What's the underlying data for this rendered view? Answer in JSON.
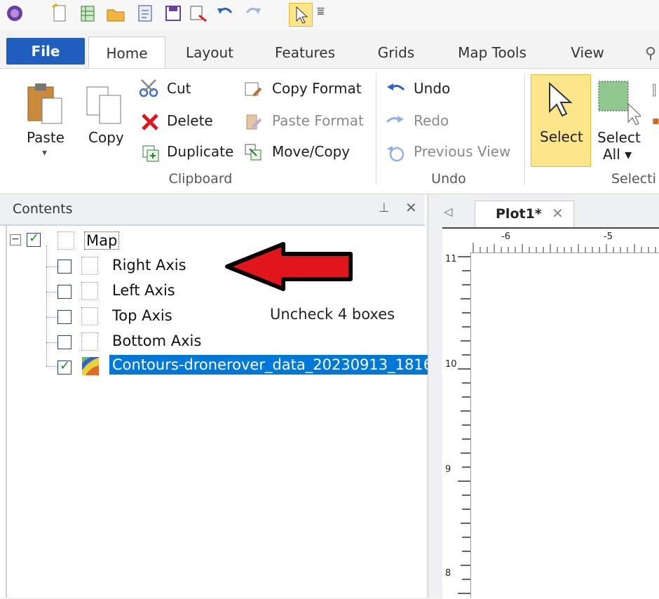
{
  "tabs": [
    "File",
    "Home",
    "Layout",
    "Features",
    "Grids",
    "Map Tools",
    "View"
  ],
  "ribbon": {
    "clipboard": {
      "paste": "Paste",
      "copy": "Copy",
      "cut": "Cut",
      "delete": "Delete",
      "duplicate": "Duplicate",
      "copy_format": "Copy Format",
      "paste_format": "Paste Format",
      "move_copy": "Move/Copy",
      "label": "Clipboard"
    },
    "undo": {
      "undo": "Undo",
      "redo": "Redo",
      "previous_view": "Previous View",
      "label": "Undo"
    },
    "selection": {
      "select": "Select",
      "select_all_line1": "Select",
      "select_all_line2": "All ▾",
      "label": "Selecti"
    }
  },
  "contents": {
    "title": "Contents",
    "items": [
      {
        "label": "Map",
        "checked": true
      },
      {
        "label": "Right Axis",
        "checked": false
      },
      {
        "label": "Left Axis",
        "checked": false
      },
      {
        "label": "Top Axis",
        "checked": false
      },
      {
        "label": "Bottom Axis",
        "checked": false
      },
      {
        "label": "Contours-dronerover_data_20230913_1816",
        "checked": true
      }
    ]
  },
  "annotation": "Uncheck 4 boxes",
  "document": {
    "tab_label": "Plot1*"
  },
  "ruler": {
    "h_labels": [
      "-6",
      "-5"
    ],
    "v_labels": [
      "11",
      "10",
      "9",
      "8"
    ]
  },
  "colors": {
    "file_tab": "#1f5ebd",
    "selection": "#0078d7",
    "select_button": "#fde68a",
    "arrow": "#e0161b"
  }
}
